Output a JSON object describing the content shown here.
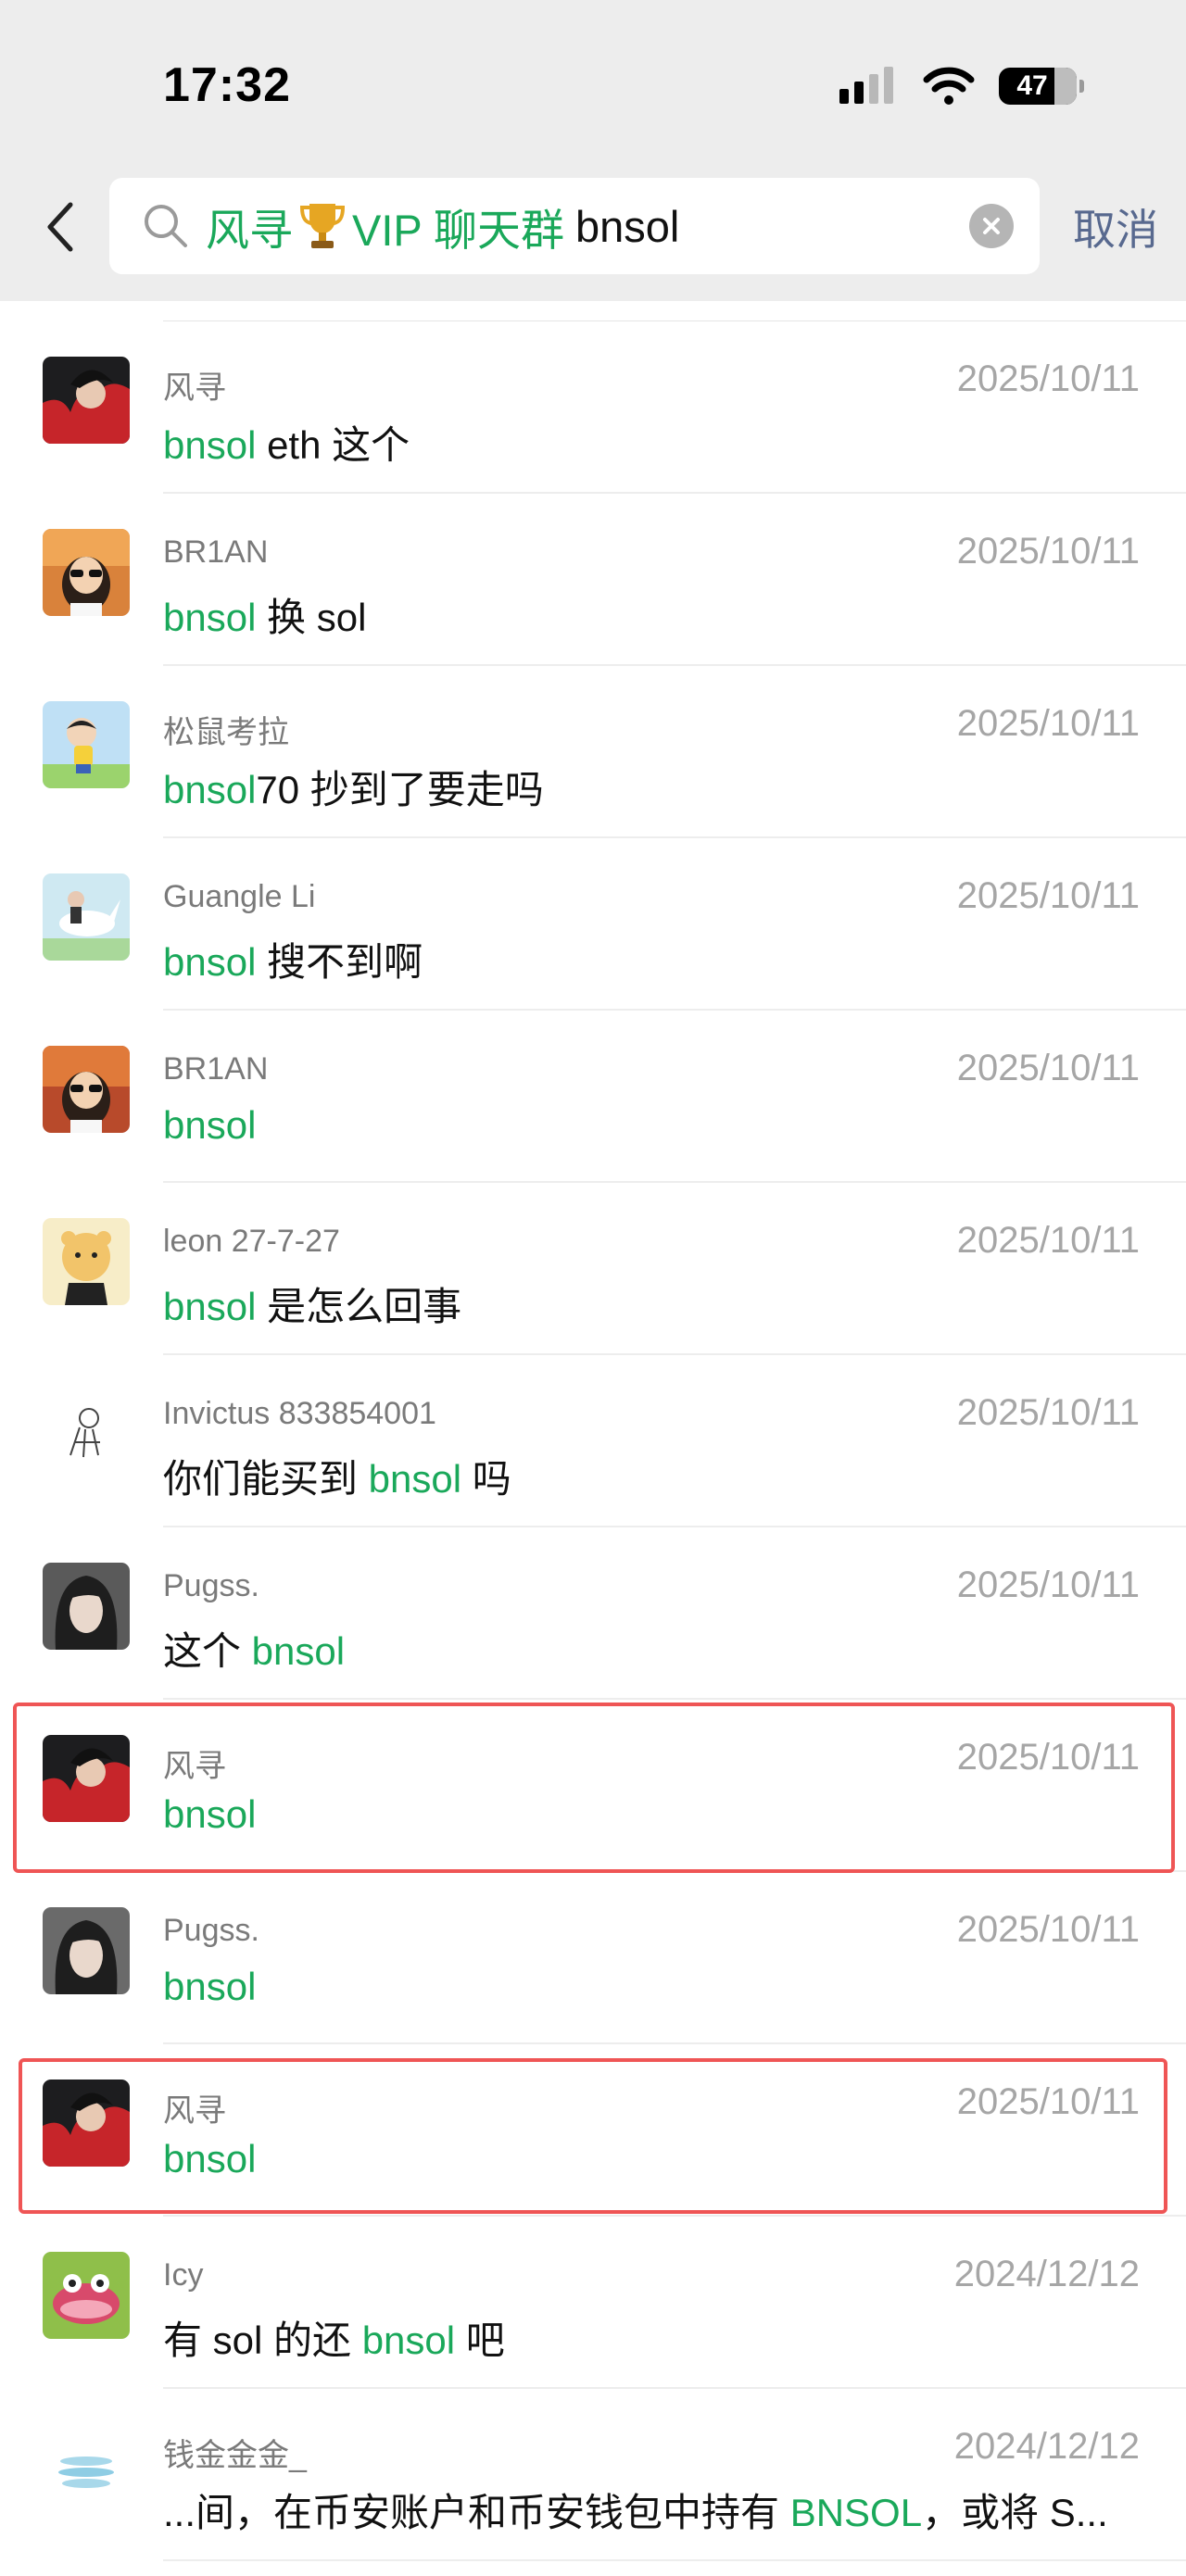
{
  "status_bar": {
    "time": "17:32",
    "battery": "47"
  },
  "search": {
    "query_prefix": "风寻",
    "query_group": "VIP 聊天群",
    "query_keyword": "bnsol",
    "cancel_label": "取消"
  },
  "results": [
    {
      "name": "风寻",
      "date": "2025/10/11",
      "pre": "",
      "hl": "bnsol",
      "post": " eth 这个"
    },
    {
      "name": "BR1AN",
      "date": "2025/10/11",
      "pre": "",
      "hl": "bnsol",
      "post": " 换 sol"
    },
    {
      "name": "松鼠考拉",
      "date": "2025/10/11",
      "pre": "",
      "hl": "bnsol",
      "post": "70 抄到了要走吗"
    },
    {
      "name": "Guangle Li",
      "date": "2025/10/11",
      "pre": "",
      "hl": "bnsol",
      "post": " 搜不到啊"
    },
    {
      "name": "BR1AN",
      "date": "2025/10/11",
      "pre": "",
      "hl": "bnsol",
      "post": ""
    },
    {
      "name": "leon 27-7-27",
      "date": "2025/10/11",
      "pre": "",
      "hl": "bnsol",
      "post": " 是怎么回事"
    },
    {
      "name": "Invictus 833854001",
      "date": "2025/10/11",
      "pre": "你们能买到 ",
      "hl": "bnsol",
      "post": " 吗"
    },
    {
      "name": "Pugss.",
      "date": "2025/10/11",
      "pre": "这个 ",
      "hl": "bnsol",
      "post": ""
    },
    {
      "name": "风寻",
      "date": "2025/10/11",
      "pre": "",
      "hl": "bnsol",
      "post": ""
    },
    {
      "name": "Pugss.",
      "date": "2025/10/11",
      "pre": "",
      "hl": "bnsol",
      "post": ""
    },
    {
      "name": "风寻",
      "date": "2025/10/11",
      "pre": "",
      "hl": "bnsol",
      "post": ""
    },
    {
      "name": "Icy",
      "date": "2024/12/12",
      "pre": "有 sol 的还 ",
      "hl": "bnsol",
      "post": " 吧"
    },
    {
      "name": "钱金金金_",
      "date": "2024/12/12",
      "pre": "...间，在币安账户和币安钱包中持有 ",
      "hl": "BNSOL",
      "post": "，或将 S..."
    }
  ],
  "colors": {
    "highlight": "#1aa85a",
    "annotation_box": "#ef5555",
    "cancel": "#58698f"
  },
  "icons": [
    "back-chevron-icon",
    "search-icon",
    "clear-icon",
    "trophy-icon",
    "signal-icon",
    "wifi-icon",
    "battery-icon"
  ]
}
